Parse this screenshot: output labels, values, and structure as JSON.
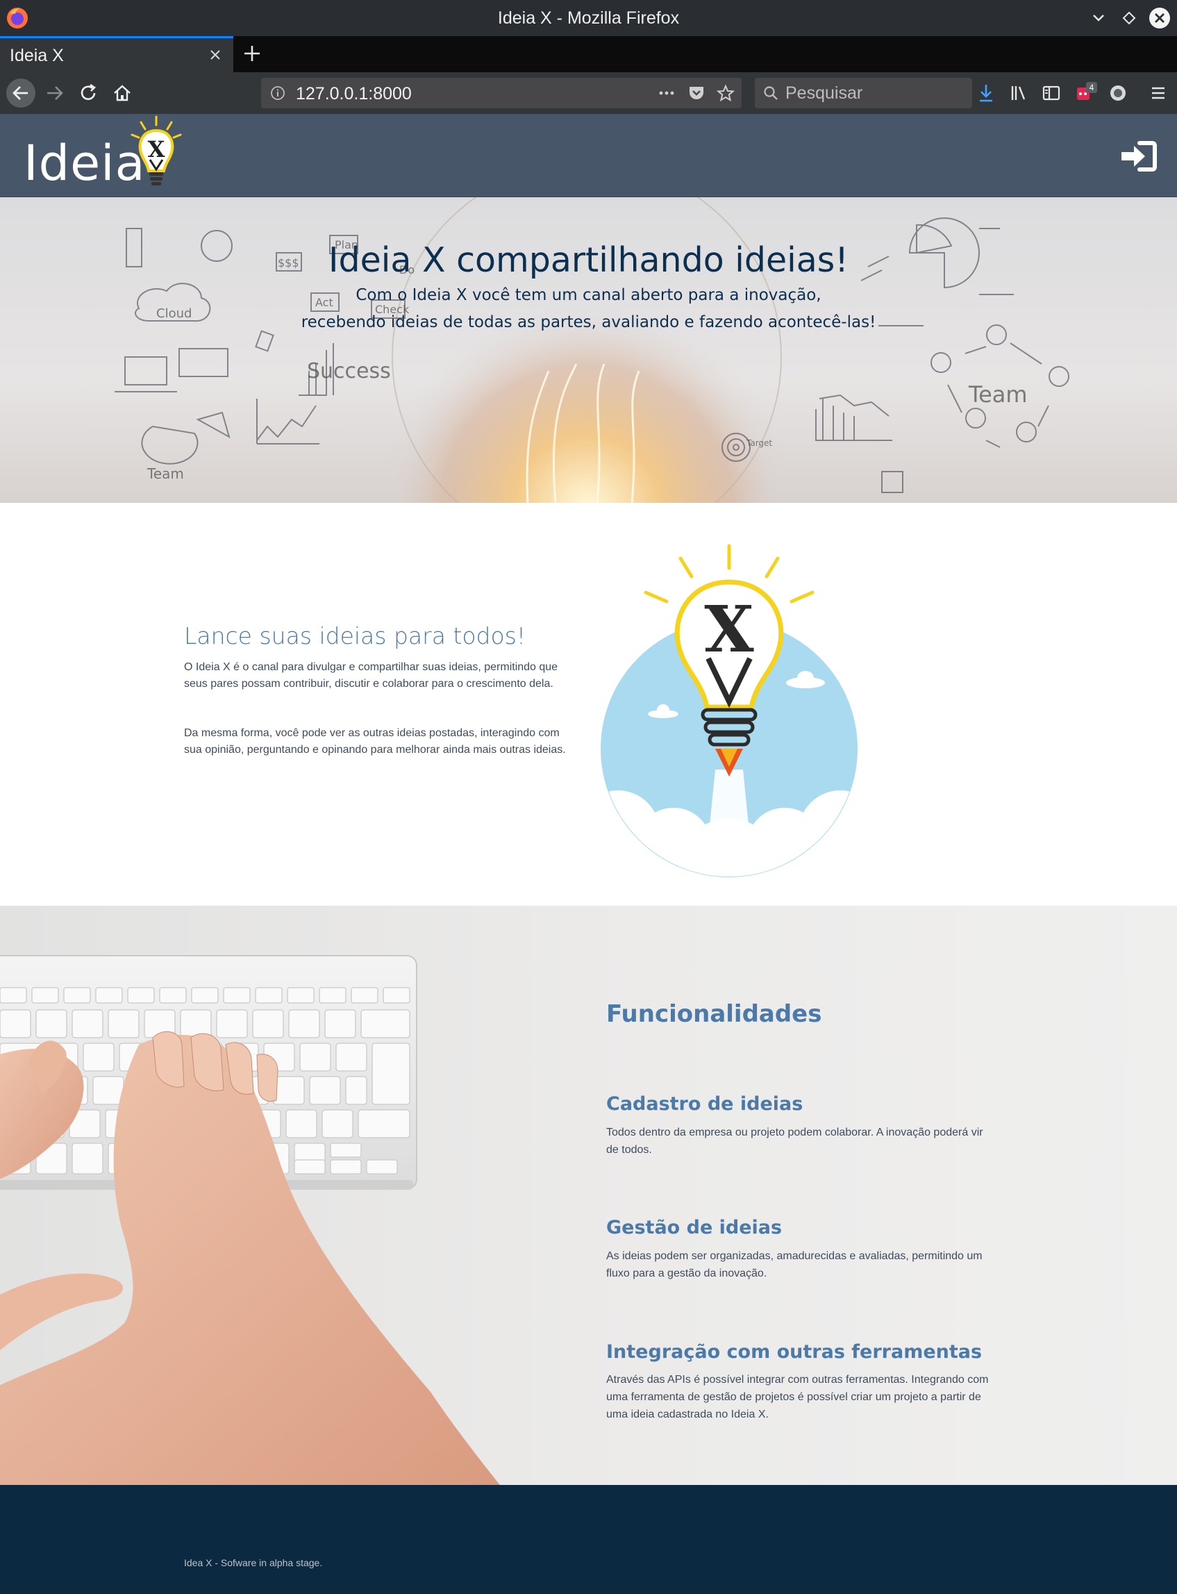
{
  "window": {
    "title": "Ideia X - Mozilla Firefox"
  },
  "tabs": [
    {
      "label": "Ideia X"
    }
  ],
  "toolbar": {
    "url": "127.0.0.1:8000",
    "search_placeholder": "Pesquisar",
    "extension_badge": "4"
  },
  "header": {
    "logo_text": "Ideia",
    "logo_mark": "X"
  },
  "hero": {
    "title": "Ideia X compartilhando ideias!",
    "subtitle_line1": "Com o Ideia X você tem um canal aberto para a inovação,",
    "subtitle_line2": "recebendo ideias de todas as partes, avaliando e fazendo acontecê-las!",
    "sketch_labels": [
      "Cloud",
      "Plan",
      "Do",
      "Act",
      "Check",
      "Success",
      "Team",
      "Team",
      "Target",
      "$$$"
    ]
  },
  "about": {
    "heading": "Lance suas ideias para todos!",
    "paragraph1": "O Ideia X é o canal para divulgar e compartilhar suas ideias, permitindo que seus pares possam contribuir, discutir e colaborar para o crescimento dela.",
    "paragraph2": "Da mesma forma, você pode ver as outras ideias postadas, interagindo com sua opinião, perguntando e opinando para melhorar ainda mais outras ideias."
  },
  "features": {
    "heading": "Funcionalidades",
    "items": [
      {
        "title": "Cadastro de ideias",
        "text": "Todos dentro da empresa ou projeto podem colaborar. A inovação poderá vir de todos."
      },
      {
        "title": "Gestão de ideias",
        "text": "As ideias podem ser organizadas,  amadurecidas e avaliadas, permitindo um fluxo para a gestão da inovação."
      },
      {
        "title": "Integração com outras ferramentas",
        "text": "Através das APIs é possível integrar com outras ferramentas. Integrando com uma ferramenta de gestão de projetos é possível criar um projeto a partir de uma ideia cadastrada no Ideia X."
      }
    ]
  },
  "footer": {
    "text": "Idea X - Sofware in alpha stage."
  },
  "colors": {
    "header_bg": "#475669",
    "accent_blue": "#4c7aa8",
    "hero_text": "#0d2f4f",
    "footer_bg": "#0b2940",
    "bulb_yellow": "#f5d21c"
  }
}
